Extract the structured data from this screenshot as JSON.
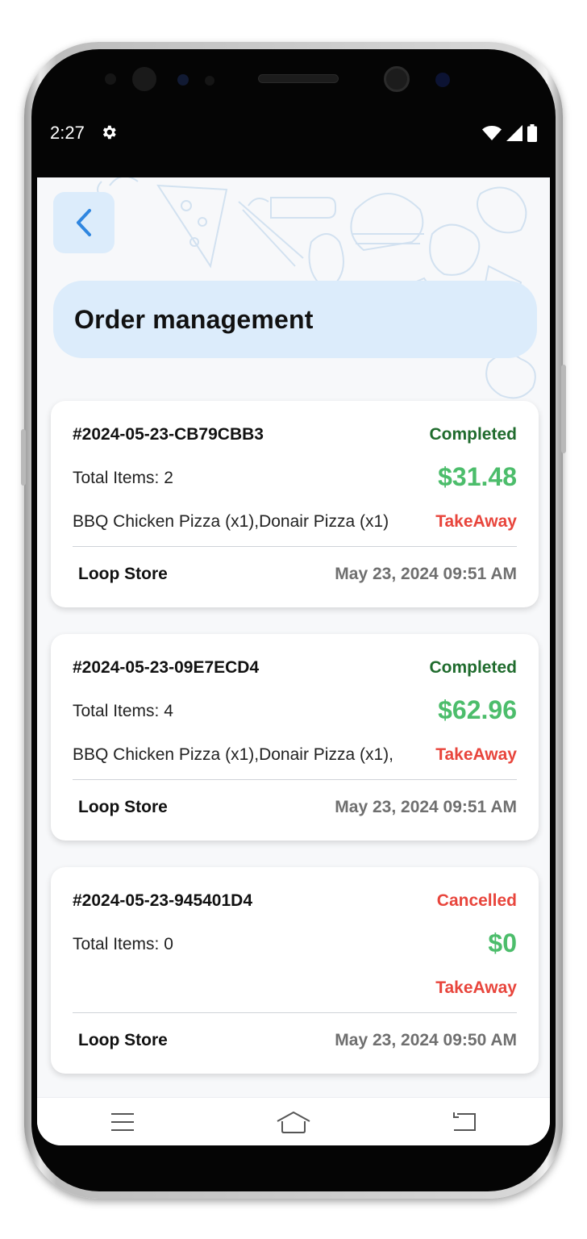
{
  "status_bar": {
    "time": "2:27",
    "icons": [
      "gear-icon",
      "wifi-icon",
      "signal-icon",
      "battery-icon"
    ]
  },
  "header": {
    "back_icon": "chevron-left-icon",
    "title": "Order management"
  },
  "colors": {
    "accent_bg": "#dcecfb",
    "completed": "#1f6b2d",
    "cancelled": "#e8453c",
    "amount": "#4cbd6b",
    "takeaway": "#e8453c",
    "back_chevron": "#2f86e0"
  },
  "orders": [
    {
      "id": "#2024-05-23-CB79CBB3",
      "status": "Completed",
      "items": "Total Items: 2",
      "amount": "$31.48",
      "description": "BBQ Chicken Pizza (x1),Donair Pizza (x1)",
      "type": "TakeAway",
      "store": "Loop Store",
      "date": "May 23, 2024 09:51 AM"
    },
    {
      "id": "#2024-05-23-09E7ECD4",
      "status": "Completed",
      "items": "Total Items: 4",
      "amount": "$62.96",
      "description": "BBQ Chicken Pizza (x1),Donair Pizza (x1),",
      "type": "TakeAway",
      "store": "Loop Store",
      "date": "May 23, 2024 09:51 AM"
    },
    {
      "id": "#2024-05-23-945401D4",
      "status": "Cancelled",
      "items": "Total Items: 0",
      "amount": "$0",
      "description": "",
      "type": "TakeAway",
      "store": "Loop Store",
      "date": "May 23, 2024 09:50 AM"
    }
  ],
  "nav_bar": {
    "icons": [
      "menu-icon",
      "home-icon",
      "back-icon"
    ]
  }
}
